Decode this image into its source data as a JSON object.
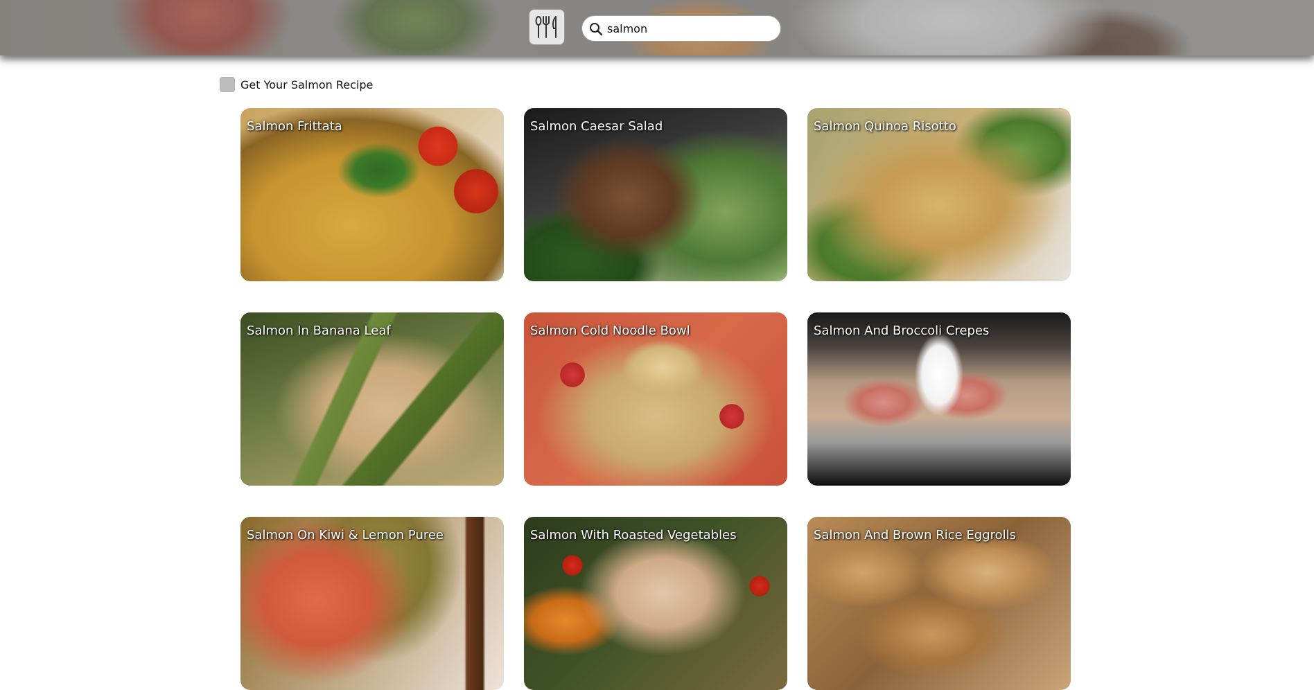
{
  "header": {
    "logo_icon": "utensils-icon",
    "search": {
      "icon": "search-icon",
      "value": "salmon",
      "placeholder": ""
    }
  },
  "filter": {
    "checkbox_checked": false,
    "label": "Get Your Salmon Recipe"
  },
  "recipes": [
    {
      "title": "Salmon Frittata"
    },
    {
      "title": "Salmon Caesar Salad"
    },
    {
      "title": "Salmon Quinoa Risotto"
    },
    {
      "title": "Salmon In Banana Leaf"
    },
    {
      "title": "Salmon Cold Noodle Bowl"
    },
    {
      "title": "Salmon And Broccoli Crepes"
    },
    {
      "title": "Salmon On Kiwi & Lemon Puree"
    },
    {
      "title": "Salmon With Roasted Vegetables"
    },
    {
      "title": "Salmon And Brown Rice Eggrolls"
    }
  ]
}
